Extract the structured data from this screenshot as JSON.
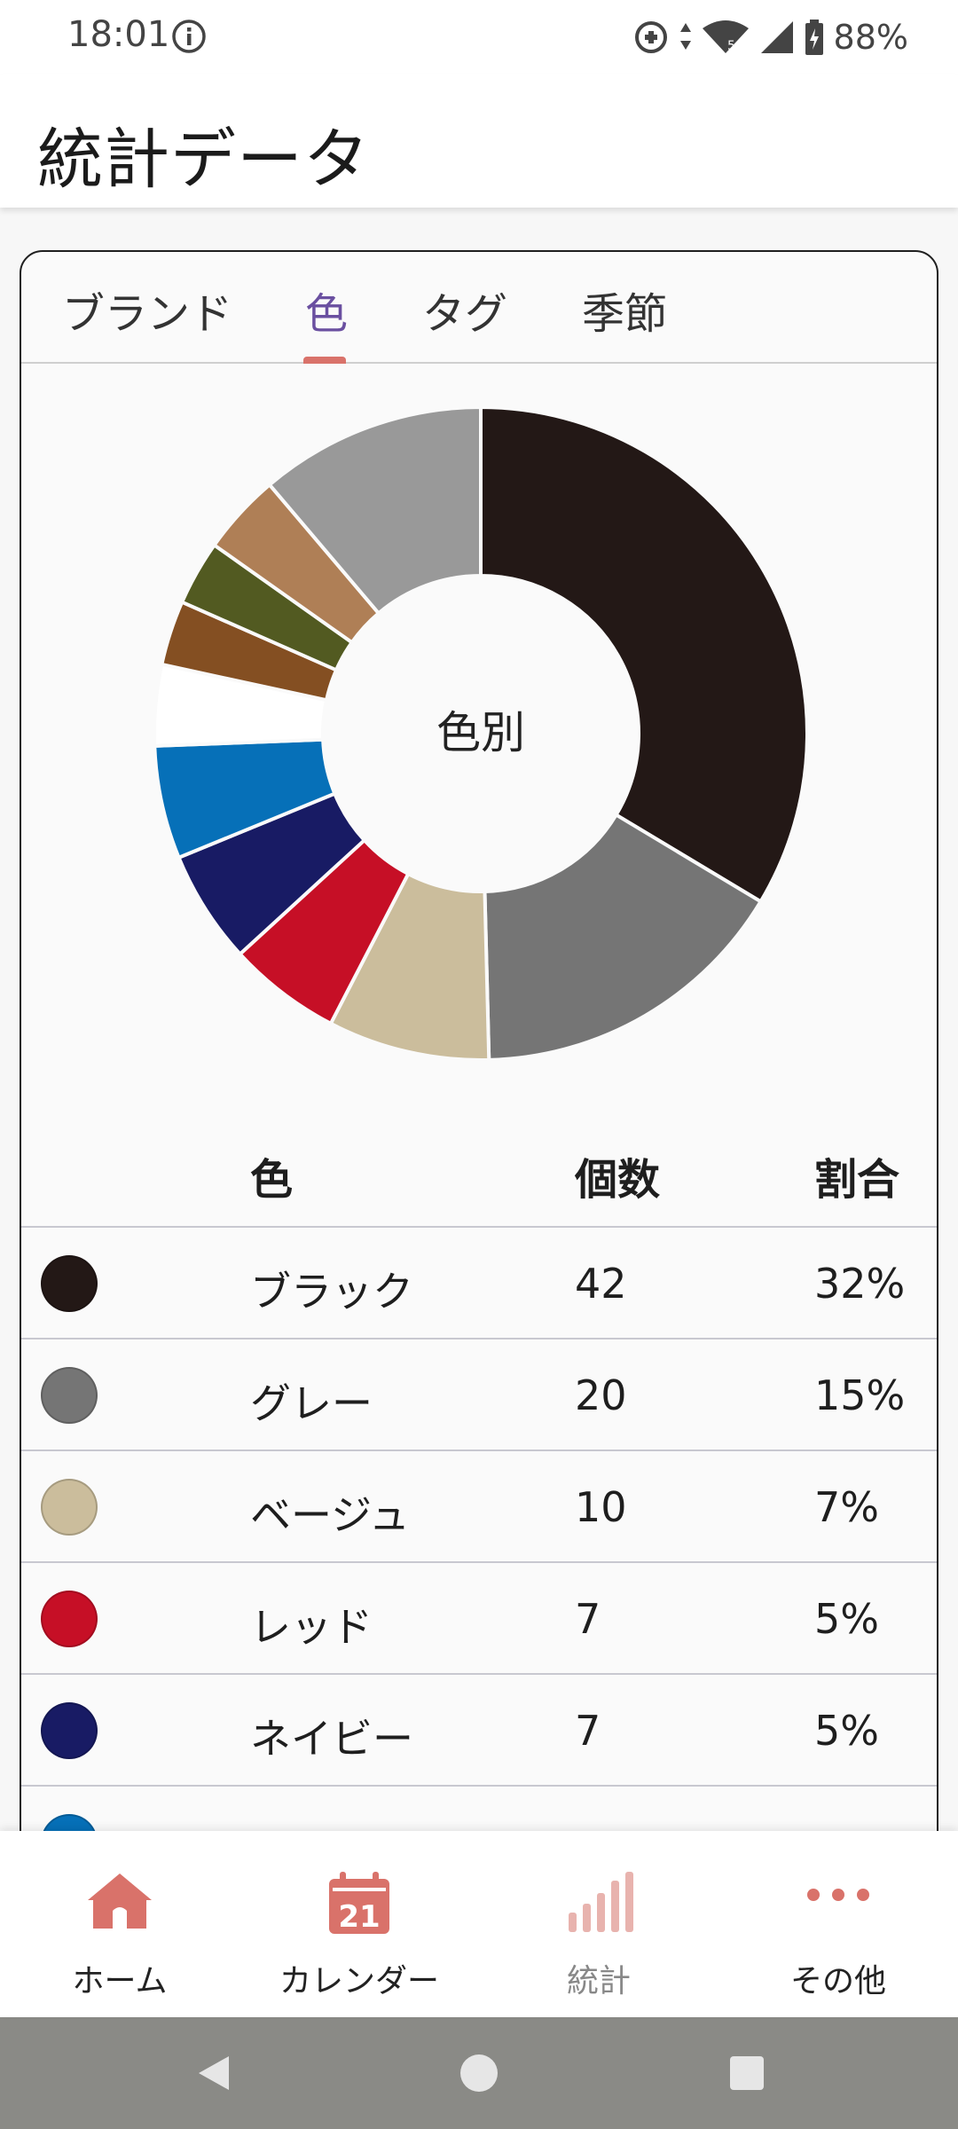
{
  "status_bar": {
    "time": "18:01",
    "battery": "88%"
  },
  "app_bar": {
    "title": "統計データ"
  },
  "tabs": [
    {
      "label": "ブランド",
      "active": false
    },
    {
      "label": "色",
      "active": true
    },
    {
      "label": "タグ",
      "active": false
    },
    {
      "label": "季節",
      "active": false
    }
  ],
  "chart_data": {
    "type": "pie",
    "center_label": "色別",
    "slices": [
      {
        "name": "ブラック",
        "value": 42,
        "color": "#231816"
      },
      {
        "name": "グレー",
        "value": 20,
        "color": "#757575"
      },
      {
        "name": "ベージュ",
        "value": 10,
        "color": "#cbbd9c"
      },
      {
        "name": "レッド",
        "value": 7,
        "color": "#c60f26"
      },
      {
        "name": "ネイビー",
        "value": 7,
        "color": "#181b64"
      },
      {
        "value": 7,
        "color": "#0670b8"
      },
      {
        "value": 5,
        "color": "#ffffff"
      },
      {
        "value": 4,
        "color": "#844f22"
      },
      {
        "value": 4,
        "color": "#525a21"
      },
      {
        "value": 5,
        "color": "#af7f56"
      },
      {
        "value": 14,
        "color": "#999999"
      }
    ]
  },
  "table": {
    "headers": {
      "color": "色",
      "count": "個数",
      "ratio": "割合"
    },
    "rows": [
      {
        "name": "ブラック",
        "count": "42",
        "ratio": "32%",
        "color": "#231816"
      },
      {
        "name": "グレー",
        "count": "20",
        "ratio": "15%",
        "color": "#757575"
      },
      {
        "name": "ベージュ",
        "count": "10",
        "ratio": "7%",
        "color": "#cbbd9c"
      },
      {
        "name": "レッド",
        "count": "7",
        "ratio": "5%",
        "color": "#c60f26"
      },
      {
        "name": "ネイビー",
        "count": "7",
        "ratio": "5%",
        "color": "#181b64"
      },
      {
        "name": "",
        "count": "",
        "ratio": "",
        "color": "#0670b8"
      }
    ]
  },
  "bottom_nav": [
    {
      "label": "ホーム",
      "icon": "home-icon"
    },
    {
      "label": "カレンダー",
      "icon": "calendar-icon",
      "badge": "21"
    },
    {
      "label": "統計",
      "icon": "stats-icon",
      "active": true
    },
    {
      "label": "その他",
      "icon": "more-icon"
    }
  ],
  "colors": {
    "accent": "#d9726a",
    "tab_active": "#6a4fa0"
  }
}
